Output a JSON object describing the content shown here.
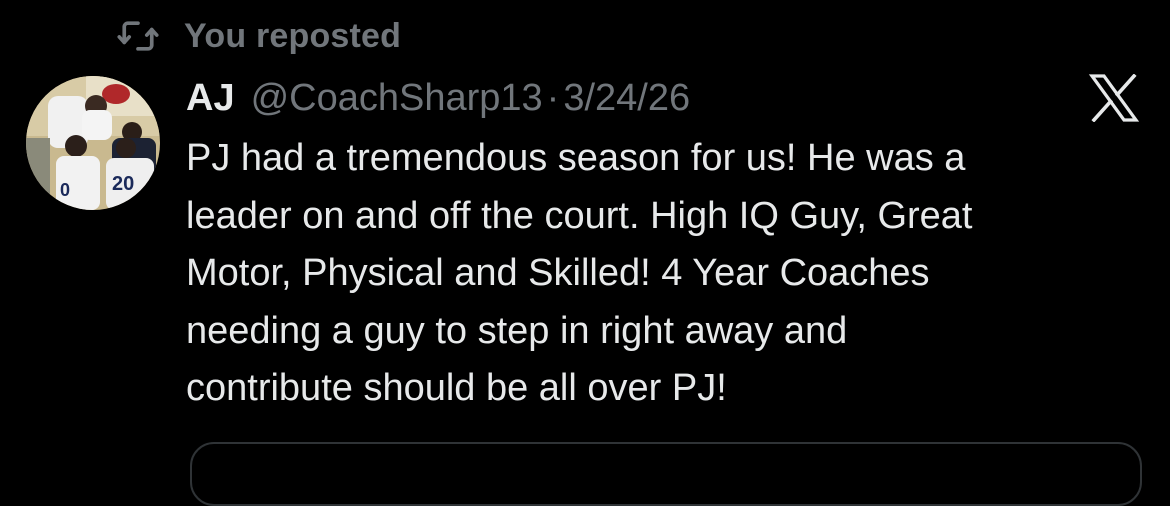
{
  "repost": {
    "label": "You reposted",
    "icon": "repost-icon"
  },
  "tweet": {
    "display_name": "AJ",
    "handle": "@CoachSharp13",
    "separator": "·",
    "date": "3/24/26",
    "text": "PJ had a tremendous season for us! He was a\nleader on and off the court. High IQ Guy, Great\nMotor, Physical and Skilled! 4 Year Coaches\nneeding a guy to step in right away and\ncontribute should be all over PJ!",
    "avatar": {
      "jersey_numbers": [
        "0",
        "20"
      ]
    }
  },
  "brand": {
    "icon": "x-logo-icon"
  },
  "colors": {
    "background": "#000000",
    "primary_text": "#e7e9ea",
    "secondary_text": "#71767b",
    "border": "#2f3336"
  }
}
